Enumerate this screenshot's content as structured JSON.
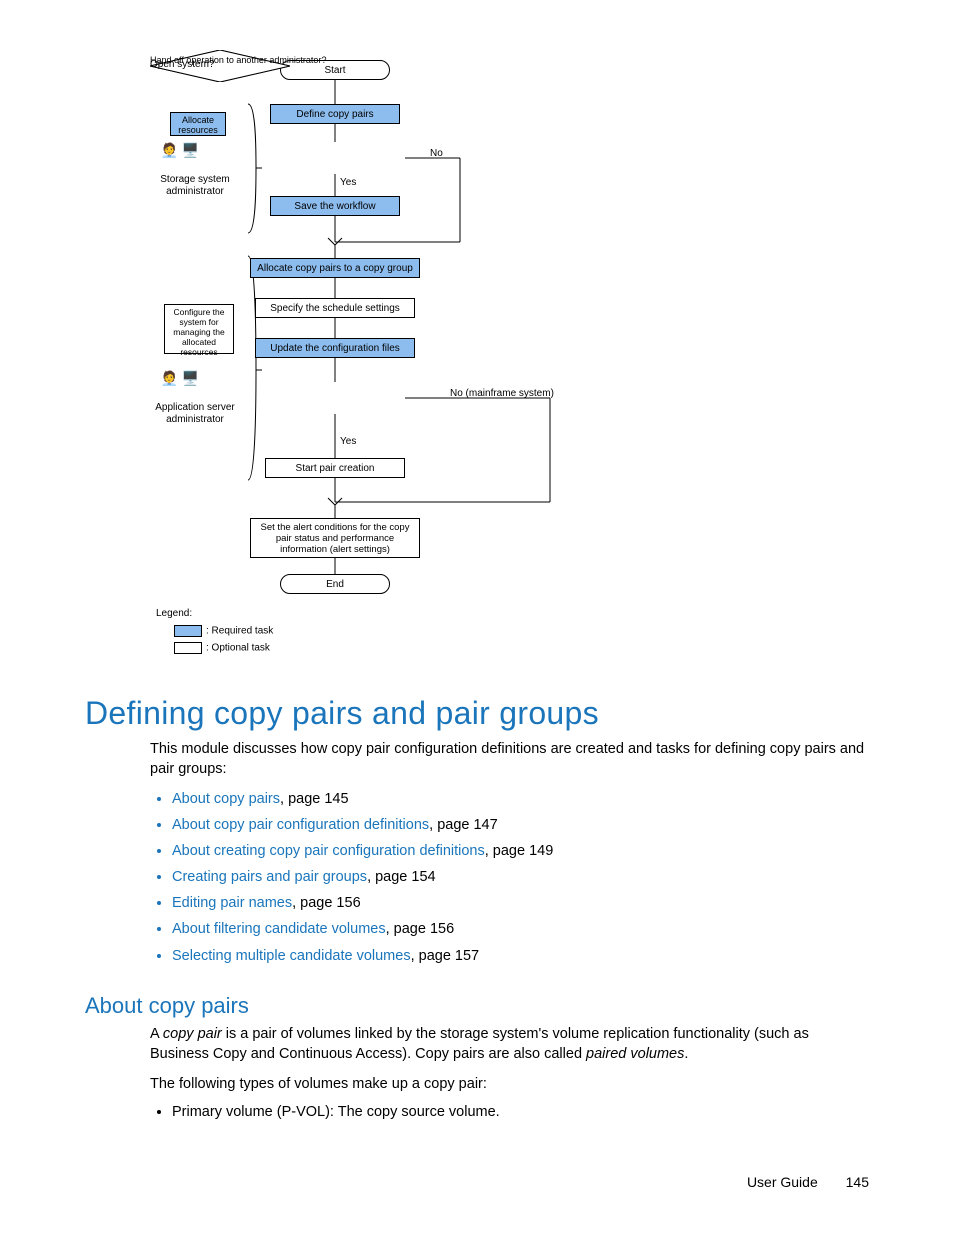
{
  "flowchart": {
    "start": "Start",
    "define_copy_pairs": "Define copy pairs",
    "handoff_decision": "Hand off operation to another administrator?",
    "handoff_no": "No",
    "handoff_yes": "Yes",
    "save_workflow": "Save the workflow",
    "allocate_pairs": "Allocate copy pairs to a copy group",
    "schedule": "Specify the schedule settings",
    "update_config": "Update the configuration files",
    "open_system_decision": "Open system?",
    "open_system_no": "No (mainframe system)",
    "open_system_yes": "Yes",
    "start_pair": "Start pair creation",
    "alert_conditions": "Set the alert conditions for the copy pair status and performance information (alert settings)",
    "end": "End",
    "allocate_resources": "Allocate resources",
    "storage_admin": "Storage system administrator",
    "configure_system": "Configure the system for managing the allocated resources",
    "app_server_admin": "Application server administrator",
    "legend": "Legend:",
    "legend_required": ": Required task",
    "legend_optional": ": Optional task"
  },
  "heading1": "Defining copy pairs and pair groups",
  "intro": "This module discusses how copy pair configuration definitions are created and tasks for defining copy pairs and pair groups:",
  "links": [
    {
      "text": "About copy pairs",
      "page": ", page 145"
    },
    {
      "text": "About copy pair configuration definitions",
      "page": ", page 147"
    },
    {
      "text": "About creating copy pair configuration definitions",
      "page": ", page 149"
    },
    {
      "text": "Creating pairs and pair groups",
      "page": ", page 154"
    },
    {
      "text": "Editing pair names",
      "page": ", page 156"
    },
    {
      "text": "About filtering candidate volumes",
      "page": ", page 156"
    },
    {
      "text": "Selecting multiple candidate volumes",
      "page": ", page 157"
    }
  ],
  "heading2": "About copy pairs",
  "para1_prefix": "A ",
  "para1_em": "copy pair",
  "para1_mid": " is a pair of volumes linked by the storage system's volume replication functionality (such as Business Copy and Continuous Access). Copy pairs are also called ",
  "para1_em2": "paired volumes",
  "para1_suffix": ".",
  "para2": "The following types of volumes make up a copy pair:",
  "bullet1": "Primary volume (P-VOL): The copy source volume.",
  "footer_label": "User Guide",
  "footer_page": "145"
}
